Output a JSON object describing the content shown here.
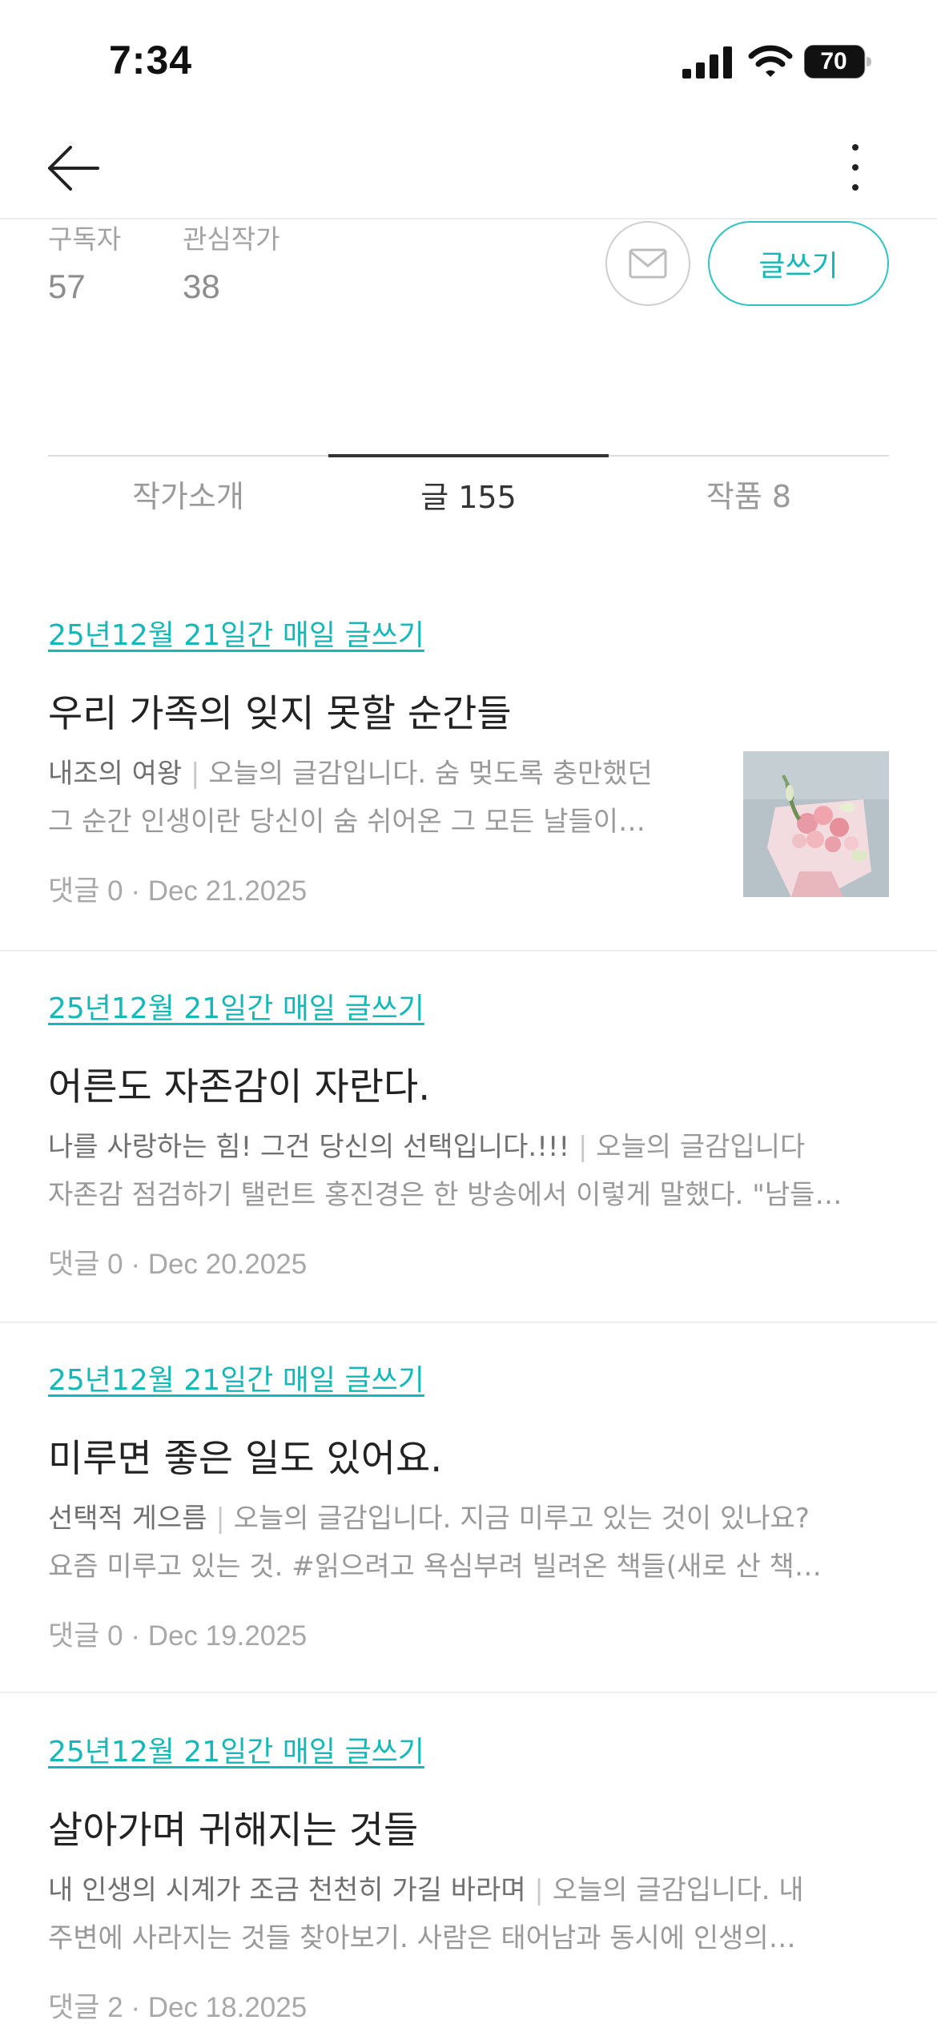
{
  "status_bar": {
    "time": "7:34",
    "battery": "70"
  },
  "nav": {
    "back_icon": "arrow-left-icon",
    "more_icon": "vertical-dots-icon"
  },
  "profile_stats": {
    "subscribers_label": "구독자",
    "subscribers_value": "57",
    "following_label": "관심작가",
    "following_value": "38"
  },
  "actions": {
    "mail_icon": "envelope-icon",
    "write_label": "글쓰기"
  },
  "tabs": [
    {
      "label": "작가소개",
      "active": false
    },
    {
      "label": "글 155",
      "active": true
    },
    {
      "label": "작품 8",
      "active": false
    }
  ],
  "posts": [
    {
      "magazine": "25년12월 21일간 매일 글쓰기",
      "title": "우리 가족의 잊지 못할 순간들",
      "subtitle": "내조의 여왕",
      "excerpt_line1": " 오늘의 글감입니다. 숨 멎도록 충만했던",
      "excerpt_line2": "그 순간 인생이란 당신이 숨 쉬어온 그 모든 날들이…",
      "meta": "댓글 0 · Dec 21.2025",
      "has_thumbnail": true
    },
    {
      "magazine": "25년12월 21일간 매일 글쓰기",
      "title": "어른도 자존감이 자란다.",
      "subtitle": "나를 사랑하는 힘! 그건 당신의 선택입니다.!!!",
      "excerpt_line1": " 오늘의 글감입니다",
      "excerpt_line2": "자존감 점검하기 탤런트 홍진경은 한 방송에서 이렇게 말했다. \"남들…",
      "meta": "댓글 0 · Dec 20.2025",
      "has_thumbnail": false
    },
    {
      "magazine": "25년12월 21일간 매일 글쓰기",
      "title": "미루면 좋은 일도 있어요.",
      "subtitle": "선택적 게으름",
      "excerpt_line1": " 오늘의 글감입니다. 지금 미루고 있는 것이 있나요?",
      "excerpt_line2": "요즘 미루고 있는 것.  #읽으려고 욕심부려 빌려온 책들(새로 산 책…",
      "meta": "댓글 0 · Dec 19.2025",
      "has_thumbnail": false
    },
    {
      "magazine": "25년12월 21일간 매일 글쓰기",
      "title": "살아가며 귀해지는 것들",
      "subtitle": "내 인생의 시계가 조금 천천히 가길 바라며",
      "excerpt_line1": " 오늘의 글감입니다. 내",
      "excerpt_line2": "주변에 사라지는 것들 찾아보기.   사람은 태어남과 동시에 인생의…",
      "meta": "댓글 2 · Dec 18.2025",
      "has_thumbnail": false
    }
  ],
  "separator": "|",
  "colors": {
    "accent": "#14b8b8",
    "text_primary": "#222222",
    "text_muted": "#999999"
  }
}
